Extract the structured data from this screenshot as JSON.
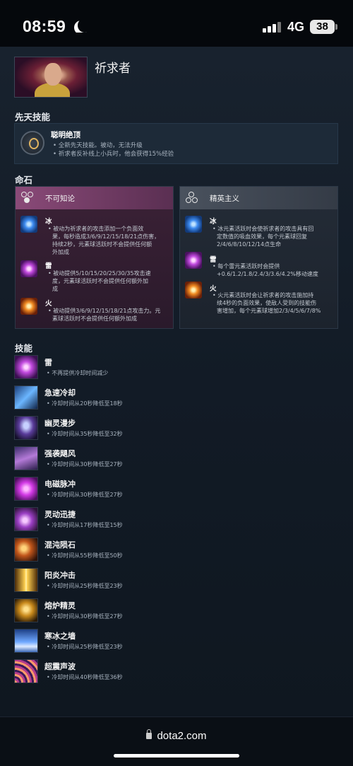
{
  "status_bar": {
    "time": "08:59",
    "network": "4G",
    "battery": "38"
  },
  "hero": {
    "name": "祈求者"
  },
  "innate": {
    "section_title": "先天技能",
    "name": "聪明绝顶",
    "lines": [
      "• 全新先天技能。被动，无法升级",
      "• 祈求者反补线上小兵时，他会获得15%经验"
    ]
  },
  "facets": {
    "section_title": "命石",
    "items": [
      {
        "title": "不可知论",
        "accent": "#7a3a68",
        "orbs": [
          {
            "name": "冰",
            "lines": [
              "• 被动为祈求者的攻击添加一个负面效",
              "果，每秒造成3/6/9/12/15/18/21点伤害，",
              "持续2秒，元素球活跃时不会提供任何额",
              "外加成"
            ]
          },
          {
            "name": "雷",
            "lines": [
              "• 被动提供5/10/15/20/25/30/35攻击速",
              "度，元素球活跃时不会提供任何额外加",
              "成"
            ]
          },
          {
            "name": "火",
            "lines": [
              "• 被动提供3/6/9/12/15/18/21点攻击力。元",
              "素球活跃时不会提供任何额外加成"
            ]
          }
        ]
      },
      {
        "title": "精英主义",
        "accent": "#3a4250",
        "orbs": [
          {
            "name": "冰",
            "lines": [
              "• 冰元素活跃时会使祈求者的攻击具有回",
              "定数值的吸血效果，每个元素球回复",
              "2/4/6/8/10/12/14点生命"
            ]
          },
          {
            "name": "雷",
            "lines": [
              "• 每个雷元素活跃时会提供",
              "+0.6/1.2/1.8/2.4/3/3.6/4.2%移动速度"
            ]
          },
          {
            "name": "火",
            "lines": [
              "• 火元素活跃时会让祈求者的攻击施加持",
              "续4秒的负面效果，使敌人受到的技能伤",
              "害增加，每个元素球增加2/3/4/5/6/7/8%"
            ]
          }
        ]
      }
    ]
  },
  "abilities": {
    "section_title": "技能",
    "items": [
      {
        "name": "雷",
        "desc": "• 不再提供冷却时间减少"
      },
      {
        "name": "急速冷却",
        "desc": "• 冷却时间从20秒降低至18秒"
      },
      {
        "name": "幽灵漫步",
        "desc": "• 冷却时间从35秒降低至32秒"
      },
      {
        "name": "强袭飓风",
        "desc": "• 冷却时间从30秒降低至27秒"
      },
      {
        "name": "电磁脉冲",
        "desc": "• 冷却时间从30秒降低至27秒"
      },
      {
        "name": "灵动迅捷",
        "desc": "• 冷却时间从17秒降低至15秒"
      },
      {
        "name": "混沌陨石",
        "desc": "• 冷却时间从55秒降低至50秒"
      },
      {
        "name": "阳炎冲击",
        "desc": "• 冷却时间从25秒降低至23秒"
      },
      {
        "name": "熔炉精灵",
        "desc": "• 冷却时间从30秒降低至27秒"
      },
      {
        "name": "寒冰之墙",
        "desc": "• 冷却时间从25秒降低至23秒"
      },
      {
        "name": "超震声波",
        "desc": "• 冷却时间从40秒降低至36秒"
      }
    ]
  },
  "browser": {
    "url": "dota2.com"
  }
}
